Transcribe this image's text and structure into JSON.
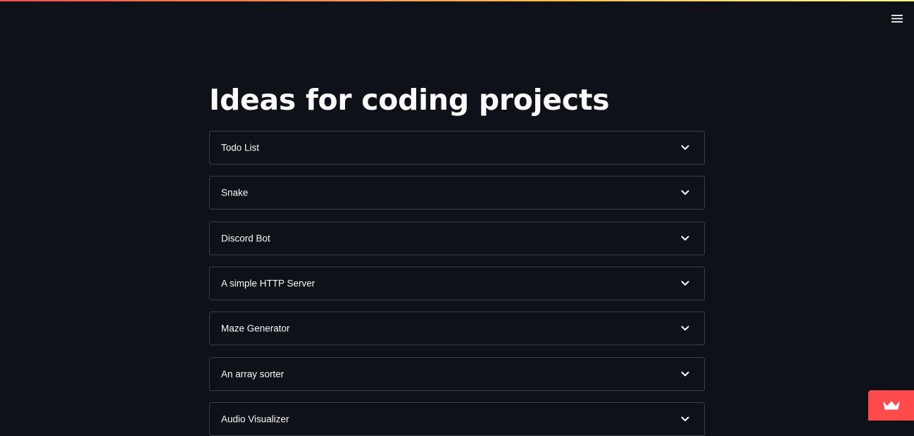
{
  "header": {
    "menu_icon": "hamburger-icon"
  },
  "main": {
    "title": "Ideas for coding projects",
    "expanders": [
      {
        "label": "Todo List",
        "icon": "chevron-down-icon"
      },
      {
        "label": "Snake",
        "icon": "chevron-down-icon"
      },
      {
        "label": "Discord Bot",
        "icon": "chevron-down-icon"
      },
      {
        "label": "A simple HTTP Server",
        "icon": "chevron-down-icon"
      },
      {
        "label": "Maze Generator",
        "icon": "chevron-down-icon"
      },
      {
        "label": "An array sorter",
        "icon": "chevron-down-icon"
      },
      {
        "label": "Audio Visualizer",
        "icon": "chevron-down-icon"
      }
    ]
  },
  "footer": {
    "badge_icon": "crown-icon"
  },
  "colors": {
    "background": "#0e1117",
    "text": "#fafafa",
    "accent": "#ff4b4b",
    "decoration_gradient_start": "#ff4b4b",
    "decoration_gradient_end": "#fffd80"
  }
}
